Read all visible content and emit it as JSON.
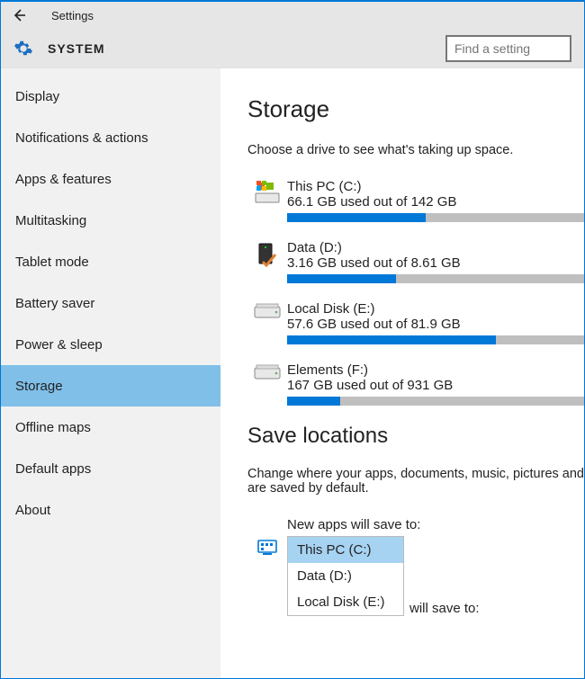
{
  "titlebar": {
    "title": "Settings"
  },
  "header": {
    "section": "SYSTEM"
  },
  "search": {
    "placeholder": "Find a setting"
  },
  "sidebar": {
    "items": [
      {
        "label": "Display",
        "selected": false
      },
      {
        "label": "Notifications & actions",
        "selected": false
      },
      {
        "label": "Apps & features",
        "selected": false
      },
      {
        "label": "Multitasking",
        "selected": false
      },
      {
        "label": "Tablet mode",
        "selected": false
      },
      {
        "label": "Battery saver",
        "selected": false
      },
      {
        "label": "Power & sleep",
        "selected": false
      },
      {
        "label": "Storage",
        "selected": true
      },
      {
        "label": "Offline maps",
        "selected": false
      },
      {
        "label": "Default apps",
        "selected": false
      },
      {
        "label": "About",
        "selected": false
      }
    ]
  },
  "main": {
    "heading": "Storage",
    "description": "Choose a drive to see what's taking up space.",
    "drives": [
      {
        "name": "This PC (C:)",
        "used_text": "66.1 GB used out of 142 GB",
        "used": 66.1,
        "total": 142,
        "icon": "windows-drive-icon"
      },
      {
        "name": "Data (D:)",
        "used_text": "3.16 GB used out of 8.61 GB",
        "used": 3.16,
        "total": 8.61,
        "icon": "drive-orange-check-icon"
      },
      {
        "name": "Local Disk (E:)",
        "used_text": "57.6 GB used out of 81.9 GB",
        "used": 57.6,
        "total": 81.9,
        "icon": "hdd-icon"
      },
      {
        "name": "Elements (F:)",
        "used_text": "167 GB used out of 931 GB",
        "used": 167,
        "total": 931,
        "icon": "hdd-icon"
      }
    ],
    "save_locations": {
      "heading": "Save locations",
      "description": "Change where your apps, documents, music, pictures and are saved by default.",
      "new_apps_label": "New apps will save to:",
      "options": [
        {
          "label": "This PC (C:)",
          "selected": true
        },
        {
          "label": "Data (D:)",
          "selected": false
        },
        {
          "label": "Local Disk (E:)",
          "selected": false
        }
      ],
      "trailing_text": "will save to:"
    }
  }
}
